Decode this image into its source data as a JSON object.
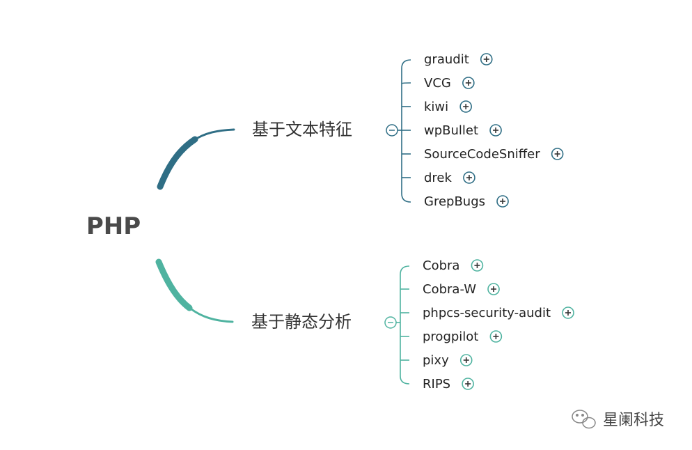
{
  "root": {
    "label": "PHP"
  },
  "branches": [
    {
      "label": "基于文本特征",
      "color": "#2f6e85",
      "leaf_color": "#2f6e85",
      "collapse_icon": "minus-circle-icon",
      "leaves": [
        {
          "label": "graudit"
        },
        {
          "label": "VCG"
        },
        {
          "label": "kiwi"
        },
        {
          "label": "wpBullet"
        },
        {
          "label": "SourceCodeSniffer"
        },
        {
          "label": "drek"
        },
        {
          "label": "GrepBugs"
        }
      ]
    },
    {
      "label": "基于静态分析",
      "color": "#4fb3a0",
      "leaf_color": "#4fb3a0",
      "collapse_icon": "minus-circle-icon",
      "leaves": [
        {
          "label": "Cobra"
        },
        {
          "label": "Cobra-W"
        },
        {
          "label": "phpcs-security-audit"
        },
        {
          "label": "progpilot"
        },
        {
          "label": "pixy"
        },
        {
          "label": "RIPS"
        }
      ]
    }
  ],
  "expand_icon": "plus-circle-icon",
  "watermark": {
    "text": "星阑科技",
    "icon": "wechat-icon"
  }
}
